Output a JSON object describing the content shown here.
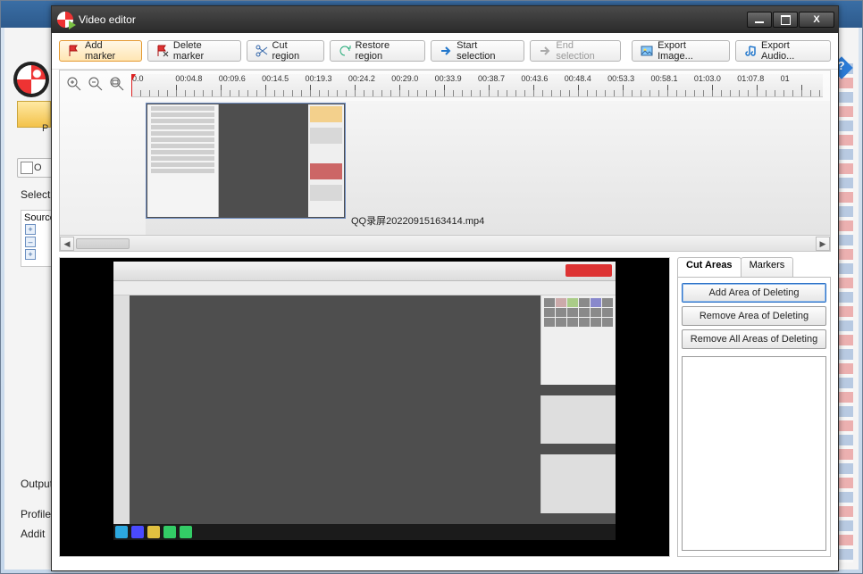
{
  "bg": {
    "preview_label": "P",
    "toolbar_label": "O",
    "select_label": "Select v",
    "source_label": "Source",
    "output_label": "Output",
    "profile_label": "Profile:",
    "addit_label": "Addit"
  },
  "window": {
    "title": "Video editor"
  },
  "toolbar": {
    "add_marker": "Add marker",
    "delete_marker": "Delete marker",
    "cut_region": "Cut region",
    "restore_region": "Restore region",
    "start_selection": "Start selection",
    "end_selection": "End selection",
    "export_image": "Export Image...",
    "export_audio": "Export Audio..."
  },
  "timeline": {
    "labels": [
      "0.0",
      "00:04.8",
      "00:09.6",
      "00:14.5",
      "00:19.3",
      "00:24.2",
      "00:29.0",
      "00:33.9",
      "00:38.7",
      "00:43.6",
      "00:48.4",
      "00:53.3",
      "00:58.1",
      "01:03.0",
      "01:07.8",
      "01"
    ],
    "clip_label": "QQ录屏20220915163414.mp4"
  },
  "side": {
    "tabs": {
      "cut_areas": "Cut Areas",
      "markers": "Markers"
    },
    "add": "Add Area of Deleting",
    "remove": "Remove Area of Deleting",
    "remove_all": "Remove All Areas of Deleting"
  }
}
